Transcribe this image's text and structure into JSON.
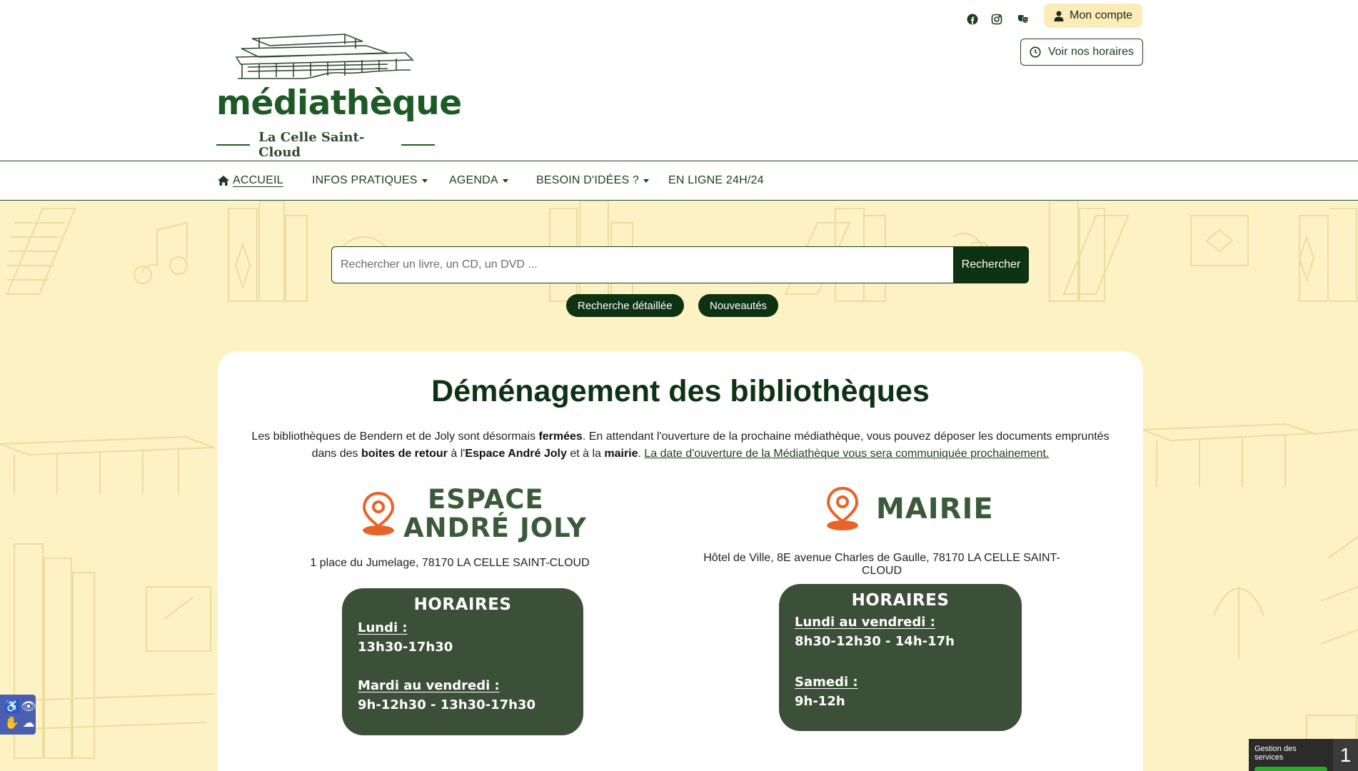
{
  "header": {
    "logo_word": "médiathèque",
    "logo_sub": "La Celle Saint-Cloud",
    "social": [
      "facebook-icon",
      "instagram-icon",
      "theater-masks-icon"
    ],
    "account_label": "Mon compte",
    "hours_label": "Voir nos horaires"
  },
  "nav": {
    "items": [
      {
        "label": "ACCUEIL",
        "icon": "home-icon"
      },
      {
        "label": "INFOS PRATIQUES",
        "dropdown": true
      },
      {
        "label": "AGENDA",
        "dropdown": true
      },
      {
        "label": "BESOIN D'IDÉES ?",
        "dropdown": true
      },
      {
        "label": "EN LIGNE 24H/24"
      }
    ]
  },
  "search": {
    "placeholder": "Rechercher un livre, un CD, un DVD ...",
    "button": "Rechercher",
    "pills": [
      "Recherche détaillée",
      "Nouveautés"
    ]
  },
  "notice": {
    "title": "Déménagement des bibliothèques",
    "t1": "Les bibliothèques de Bendern et de Joly sont désormais ",
    "b1": "fermées",
    "t2": ". En attendant l'ouverture de la prochaine médiathèque, vous pouvez déposer les documents empruntés dans des ",
    "b2": "boites de retour",
    "t3": " à l'",
    "b3": "Espace André Joly",
    "t4": " et à la ",
    "b4": "mairie",
    "t5": ". ",
    "link": "La date d'ouverture de la Médiathèque vous sera communiquée prochainement."
  },
  "locations": [
    {
      "name_line1": "ESPACE",
      "name_line2": "ANDRÉ JOLY",
      "address": "1 place du Jumelage, 78170 LA CELLE SAINT-CLOUD",
      "hours_title": "HORAIRES",
      "hours": [
        {
          "day": "Lundi :",
          "time": "13h30-17h30"
        },
        {
          "day": "Mardi au vendredi :",
          "time": "9h-12h30 -  13h30-17h30"
        }
      ]
    },
    {
      "name_line1": "MAIRIE",
      "address": "Hôtel de Ville, 8E avenue Charles de Gaulle, 78170 LA CELLE SAINT-CLOUD",
      "hours_title": "HORAIRES",
      "hours": [
        {
          "day": "Lundi au vendredi :",
          "time": "8h30-12h30 - 14h-17h"
        },
        {
          "day": "Samedi :",
          "time": "9h-12h"
        }
      ]
    }
  ],
  "cookie": {
    "label": "Gestion des services",
    "count": "1"
  },
  "colors": {
    "dark_green": "#0d3312",
    "hours_bg": "#3c4f38",
    "pin_orange": "#e8632a",
    "hero_bg": "#fdf2c4",
    "account_bg": "#fbecb8"
  }
}
